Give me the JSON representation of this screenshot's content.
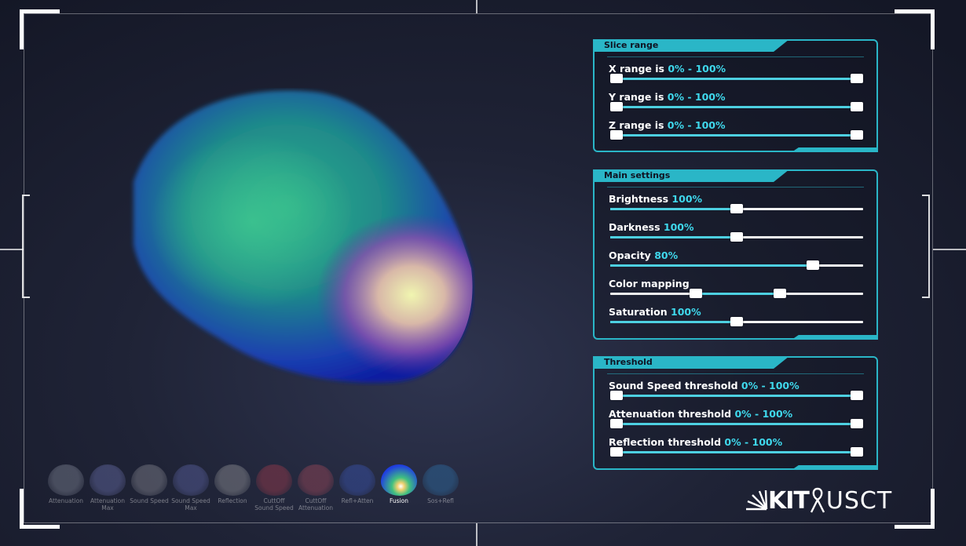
{
  "slice_range": {
    "title": "Slice range",
    "rows": [
      {
        "name": "X range is ",
        "value": "0% - 100%",
        "low": 0,
        "high": 100
      },
      {
        "name": "Y range is ",
        "value": "0% - 100%",
        "low": 0,
        "high": 100
      },
      {
        "name": "Z range is ",
        "value": "0% - 100%",
        "low": 0,
        "high": 100
      }
    ]
  },
  "main_settings": {
    "title": "Main settings",
    "rows": [
      {
        "name": "Brightness ",
        "value": "100%",
        "level": 50
      },
      {
        "name": "Darkness ",
        "value": "100%",
        "level": 50
      },
      {
        "name": "Opacity ",
        "value": "80%",
        "level": 80
      },
      {
        "name": "Color mapping",
        "value": "",
        "low": 34,
        "high": 67
      },
      {
        "name": "Saturation ",
        "value": "100%",
        "level": 50
      }
    ]
  },
  "threshold": {
    "title": "Threshold",
    "rows": [
      {
        "name": "Sound Speed threshold ",
        "value": "0% - 100%",
        "low": 0,
        "high": 100
      },
      {
        "name": "Attenuation threshold ",
        "value": "0% - 100%",
        "low": 0,
        "high": 100
      },
      {
        "name": "Reflection threshold ",
        "value": "0% - 100%",
        "low": 0,
        "high": 100
      }
    ]
  },
  "modes": [
    {
      "label": "Attenuation",
      "color": "#9aa0b0",
      "active": false
    },
    {
      "label": "Attenuation Max",
      "color": "#7c82c8",
      "active": false
    },
    {
      "label": "Sound Speed",
      "color": "#a0a0a8",
      "active": false
    },
    {
      "label": "Sound Speed Max",
      "color": "#6c74c0",
      "active": false
    },
    {
      "label": "Reflection",
      "color": "#b0b0b0",
      "active": false
    },
    {
      "label": "CuttOff Sound Speed",
      "color": "#c04050",
      "active": false
    },
    {
      "label": "CuttOff Attenuation",
      "color": "#c05060",
      "active": false
    },
    {
      "label": "Refl+Atten",
      "color": "#4060d0",
      "active": false
    },
    {
      "label": "Fusion",
      "color": "#2040e0",
      "active": true
    },
    {
      "label": "Sos+Refl",
      "color": "#3080c0",
      "active": false
    }
  ],
  "logo": {
    "kit": "KIT",
    "usct": "USCT"
  },
  "colors": {
    "accent": "#2ab6c7",
    "value_text": "#3fd8ec"
  }
}
